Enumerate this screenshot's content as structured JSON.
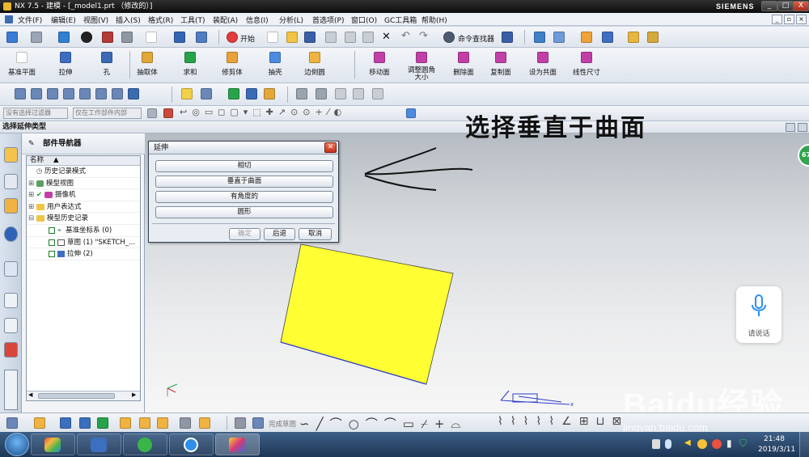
{
  "window": {
    "title": "NX 7.5 - 建模 - [_model1.prt （修改的）]",
    "brand": "SIEMENS",
    "min_label": "_",
    "max_label": "□",
    "close_label": "X"
  },
  "menubar": {
    "items": [
      "文件(F)",
      "编辑(E)",
      "视图(V)",
      "插入(S)",
      "格式(R)",
      "工具(T)",
      "装配(A)",
      "信息(I)",
      "分析(L)",
      "首选项(P)",
      "窗口(O)",
      "GC工具箱",
      "帮助(H)"
    ]
  },
  "toolbar_std": {
    "start_label": "开始",
    "cmd_finder_label": "命令查找器"
  },
  "toolbar_feature": {
    "items": [
      "基准平面",
      "拉伸",
      "孔",
      "抽取体",
      "求和",
      "修剪体",
      "抽壳",
      "边倒圆"
    ],
    "sync_items": [
      "移动面",
      "调整圆角大小",
      "删除面",
      "复制面",
      "设为共面",
      "线性尺寸"
    ]
  },
  "selection_bar": {
    "filter_value": "没有选择过滤器",
    "scope_value": "仅在工作部件内部"
  },
  "hint": {
    "text": "选择延伸类型"
  },
  "navigator": {
    "title": "部件导航器",
    "column_header": "名称",
    "rows": [
      {
        "label": "历史记录模式"
      },
      {
        "label": "模型视图"
      },
      {
        "label": "摄像机"
      },
      {
        "label": "用户表达式"
      },
      {
        "label": "模型历史记录"
      },
      {
        "label": "基准坐标系 (0)"
      },
      {
        "label": "草图 (1) \"SKETCH_..."
      },
      {
        "label": "拉伸 (2)"
      }
    ]
  },
  "dialog": {
    "title": "延伸",
    "options": [
      "相切",
      "垂直于曲面",
      "有角度的",
      "圆形"
    ],
    "ok_label": "确定",
    "back_label": "后退",
    "cancel_label": "取消"
  },
  "annotation": {
    "text": "选择垂直于曲面"
  },
  "viewport": {
    "sheet_color": "#ffff33",
    "badge_text": "67"
  },
  "voice_widget": {
    "label": "请说话"
  },
  "sketch_bar": {
    "finish_label": "完成草图"
  },
  "taskbar": {
    "time": "21:48",
    "date": "2019/3/11"
  },
  "watermark": {
    "brand": "Baidu经验",
    "url": "jingyan.baidu.com"
  },
  "colors": {
    "accent": "#2f5d93",
    "taskbar": "#1d3656",
    "close_red": "#d8442a"
  }
}
